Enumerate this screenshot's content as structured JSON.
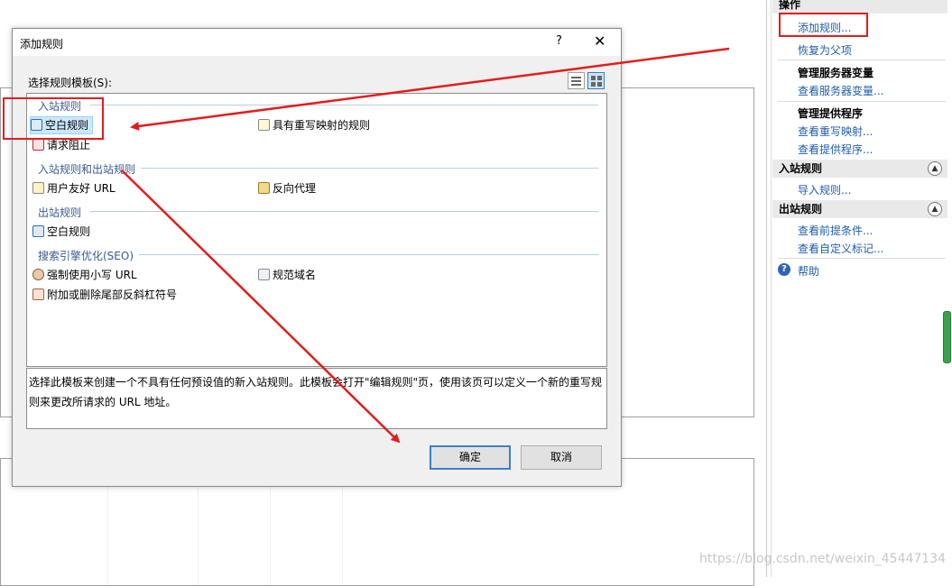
{
  "actions_pane": {
    "header": "操作",
    "add_rule": "添加规则...",
    "revert_parent": "恢复为父项",
    "manage_server_vars": "管理服务器变量",
    "view_server_vars": "查看服务器变量...",
    "manage_providers": "管理提供程序",
    "view_rewrite_maps": "查看重写映射...",
    "view_providers": "查看提供程序...",
    "inbound_header": "入站规则",
    "import_rules": "导入规则...",
    "outbound_header": "出站规则",
    "view_preconditions": "查看前提条件...",
    "view_custom_tags": "查看自定义标记...",
    "help": "帮助",
    "collapse_glyph": "▲"
  },
  "dialog": {
    "title": "添加规则",
    "help_glyph": "?",
    "close_glyph": "✕",
    "template_label": "选择规则模板(S):",
    "groups": {
      "inbound": {
        "label": "入站规则",
        "blank_rule": "空白规则",
        "rewrite_map_rule": "具有重写映射的规则",
        "request_blocking": "请求阻止"
      },
      "in_out": {
        "label": "入站规则和出站规则",
        "friendly_url": "用户友好 URL",
        "reverse_proxy": "反向代理"
      },
      "outbound": {
        "label": "出站规则",
        "blank_rule": "空白规则"
      },
      "seo": {
        "label": "搜索引擎优化(SEO)",
        "lowercase_url": "强制使用小写 URL",
        "canonical_domain": "规范域名",
        "trailing_slash": "附加或删除尾部反斜杠符号"
      }
    },
    "description": "选择此模板来创建一个不具有任何预设值的新入站规则。此模板会打开\"编辑规则\"页，使用该页可以定义一个新的重写规则来更改所请求的 URL 地址。",
    "ok_label": "确定",
    "cancel_label": "取消"
  },
  "watermark": "https://blog.csdn.net/weixin_45447134",
  "colors": {
    "annotation": "#e51b1b",
    "link": "#1f5ea8",
    "group_text": "#3b5b91",
    "selected_bg": "#cce8ff"
  }
}
